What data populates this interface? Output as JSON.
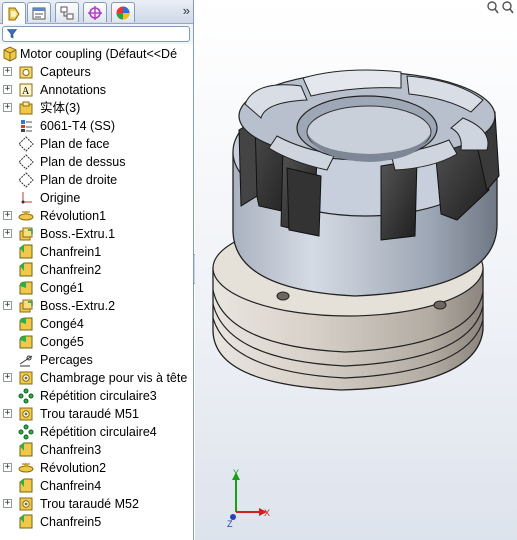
{
  "panel": {
    "tabs": [
      {
        "name": "feature-manager-tab",
        "icon": "feature-tree-icon"
      },
      {
        "name": "property-manager-tab",
        "icon": "property-icon"
      },
      {
        "name": "configuration-manager-tab",
        "icon": "configuration-icon"
      },
      {
        "name": "dimxpert-tab",
        "icon": "crosshair-icon"
      },
      {
        "name": "display-manager-tab",
        "icon": "appearance-icon"
      }
    ],
    "more": "»"
  },
  "tree": {
    "root": "Motor coupling  (Défaut<<Dé",
    "items": [
      {
        "label": "Capteurs",
        "icon": "sensor-icon",
        "expandable": true
      },
      {
        "label": "Annotations",
        "icon": "annotation-icon",
        "expandable": true
      },
      {
        "label": "实体(3)",
        "icon": "solid-bodies-icon",
        "expandable": true
      },
      {
        "label": "6061-T4 (SS)",
        "icon": "material-icon",
        "expandable": false
      },
      {
        "label": "Plan de face",
        "icon": "plane-icon",
        "expandable": false
      },
      {
        "label": "Plan de dessus",
        "icon": "plane-icon",
        "expandable": false
      },
      {
        "label": "Plan de droite",
        "icon": "plane-icon",
        "expandable": false
      },
      {
        "label": "Origine",
        "icon": "origin-icon",
        "expandable": false
      },
      {
        "label": "Révolution1",
        "icon": "revolve-icon",
        "expandable": true
      },
      {
        "label": "Boss.-Extru.1",
        "icon": "extrude-icon",
        "expandable": true
      },
      {
        "label": "Chanfrein1",
        "icon": "chamfer-icon",
        "expandable": false
      },
      {
        "label": "Chanfrein2",
        "icon": "chamfer-icon",
        "expandable": false
      },
      {
        "label": "Congé1",
        "icon": "fillet-icon",
        "expandable": false
      },
      {
        "label": "Boss.-Extru.2",
        "icon": "extrude-icon",
        "expandable": true
      },
      {
        "label": "Congé4",
        "icon": "fillet-icon",
        "expandable": false
      },
      {
        "label": "Congé5",
        "icon": "fillet-icon",
        "expandable": false
      },
      {
        "label": "Percages",
        "icon": "sketch-icon",
        "expandable": false
      },
      {
        "label": "Chambrage pour vis à tête",
        "icon": "hole-wizard-icon",
        "expandable": true
      },
      {
        "label": "Répétition circulaire3",
        "icon": "circular-pattern-icon",
        "expandable": false
      },
      {
        "label": "Trou taraudé M51",
        "icon": "hole-wizard-icon",
        "expandable": true
      },
      {
        "label": "Répétition circulaire4",
        "icon": "circular-pattern-icon",
        "expandable": false
      },
      {
        "label": "Chanfrein3",
        "icon": "chamfer-icon",
        "expandable": false
      },
      {
        "label": "Révolution2",
        "icon": "revolve-icon",
        "expandable": true
      },
      {
        "label": "Chanfrein4",
        "icon": "chamfer-icon",
        "expandable": false
      },
      {
        "label": "Trou taraudé M52",
        "icon": "hole-wizard-icon",
        "expandable": true
      },
      {
        "label": "Chanfrein5",
        "icon": "chamfer-icon",
        "expandable": false
      }
    ]
  },
  "triad": {
    "x": "X",
    "y": "Y",
    "z": "Z"
  },
  "colors": {
    "accent": "#316ac5",
    "background_top": "#ffffff",
    "background_bottom": "#dde3ec",
    "metal_light": "#c7cfdc",
    "elastomer": "#2b2b2b",
    "bronze": "#d6d0c8"
  }
}
